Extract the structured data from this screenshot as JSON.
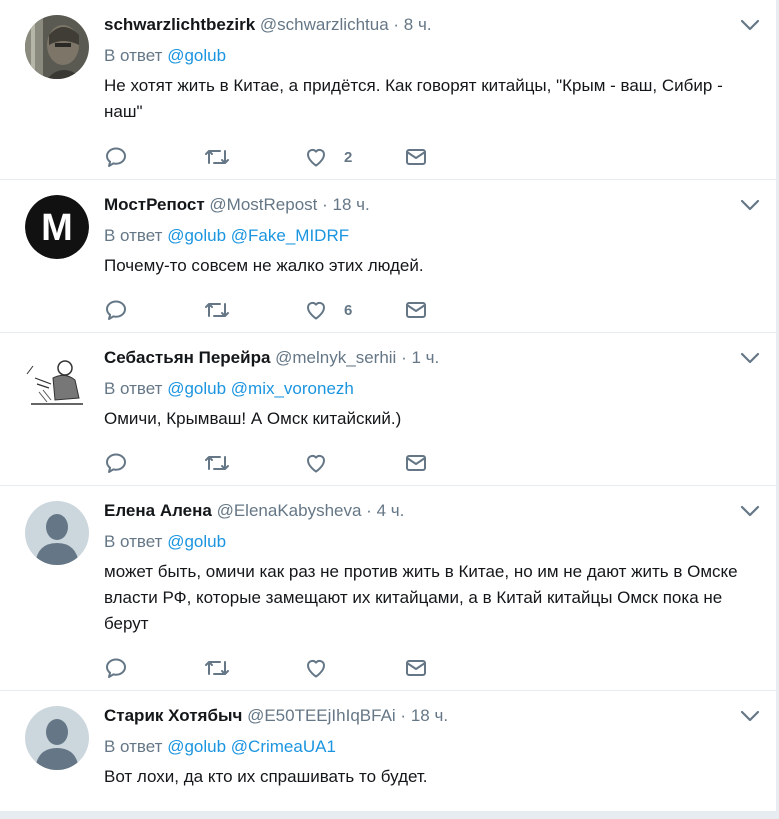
{
  "tweets": [
    {
      "name": "schwarzlichtbezirk",
      "handle": "@schwarzlichtua",
      "dot": "·",
      "time": "8 ч.",
      "reply_prefix": "В ответ",
      "mentions": [
        "@golub"
      ],
      "text": "Не хотят жить в Китае, а придётся. Как говорят китайцы, \"Крым - ваш, Сибир - наш\"",
      "likes": "2",
      "avatar_icon": "warrior-portrait"
    },
    {
      "name": "МостРепост",
      "handle": "@MostRepost",
      "dot": "·",
      "time": "18 ч.",
      "reply_prefix": "В ответ",
      "mentions": [
        "@golub",
        "@Fake_MIDRF"
      ],
      "text": "Почему-то совсем не жалко этих людей.",
      "likes": "6",
      "avatar_icon": "m-logo",
      "avatar_letter": "M"
    },
    {
      "name": "Себастьян Перейра",
      "handle": "@melnyk_serhii",
      "dot": "·",
      "time": "1 ч.",
      "reply_prefix": "В ответ",
      "mentions": [
        "@golub",
        "@mix_voronezh"
      ],
      "text": "Омичи, Крымваш! А Омск китайский.)",
      "likes": "",
      "avatar_icon": "sketch-drawing"
    },
    {
      "name": "Елена Алена",
      "handle": "@ElenaKabysheva",
      "dot": "·",
      "time": "4 ч.",
      "reply_prefix": "В ответ",
      "mentions": [
        "@golub"
      ],
      "text": "может быть, омичи как раз не против жить в Китае, но им не дают жить в Омске власти РФ, которые замещают их китайцами, а в Китай китайцы Омск пока не берут",
      "likes": "",
      "avatar_icon": "default-avatar"
    },
    {
      "name": "Старик Хотябыч",
      "handle": "@E50TEEjIhIqBFAi",
      "dot": "·",
      "time": "18 ч.",
      "reply_prefix": "В ответ",
      "mentions": [
        "@golub",
        "@CrimeaUA1"
      ],
      "text": "Вот лохи, да кто их спрашивать то будет.",
      "likes": "",
      "avatar_icon": "default-avatar"
    }
  ],
  "colors": {
    "mention": "#1b95e0",
    "secondary": "#657786",
    "divider": "#e6ecf0"
  }
}
